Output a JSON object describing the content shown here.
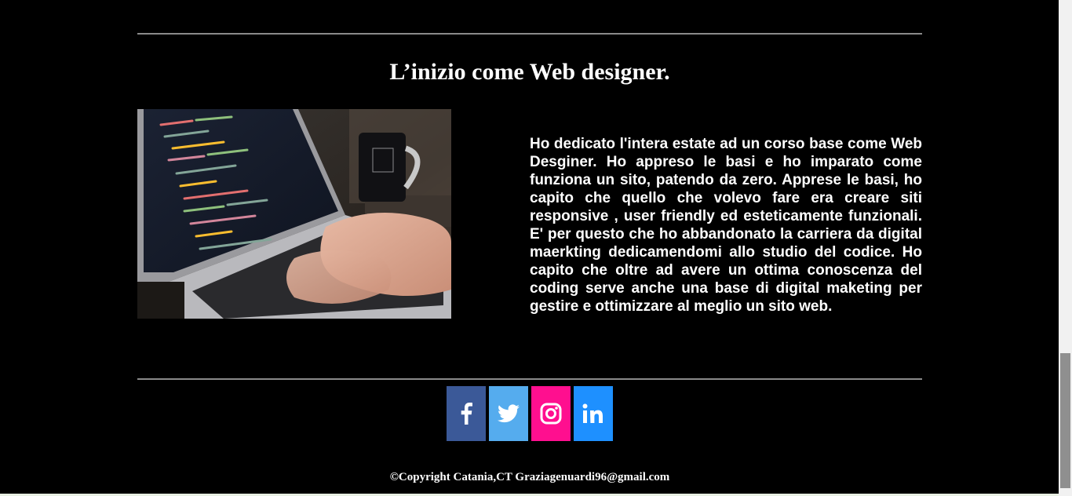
{
  "section": {
    "title": "L’inizio come Web designer.",
    "paragraph": "Ho dedicato l'intera estate ad un corso base come Web Desginer. Ho appreso le basi e ho imparato come funziona un sito, patendo da zero. Apprese le basi, ho capito che quello che volevo fare era creare siti responsive , user friendly ed esteticamente funzionali. E' per questo che ho abbandonato la carriera da digital maerkting dedicamendomi allo studio del codice. Ho capito che oltre ad avere un ottima conoscenza del coding serve anche una base di digital maketing per gestire e ottimizzare al meglio un sito web."
  },
  "social": [
    {
      "name": "facebook",
      "icon": "facebook-icon",
      "color": "#3b5998"
    },
    {
      "name": "twitter",
      "icon": "twitter-icon",
      "color": "#55acee"
    },
    {
      "name": "instagram",
      "icon": "instagram-icon",
      "color": "#ff0f8f"
    },
    {
      "name": "linkedin",
      "icon": "linkedin-icon",
      "color": "#1e90ff"
    }
  ],
  "footer": {
    "copyright": "©Copyright Catania,CT Graziagenuardi96@gmail.com"
  }
}
